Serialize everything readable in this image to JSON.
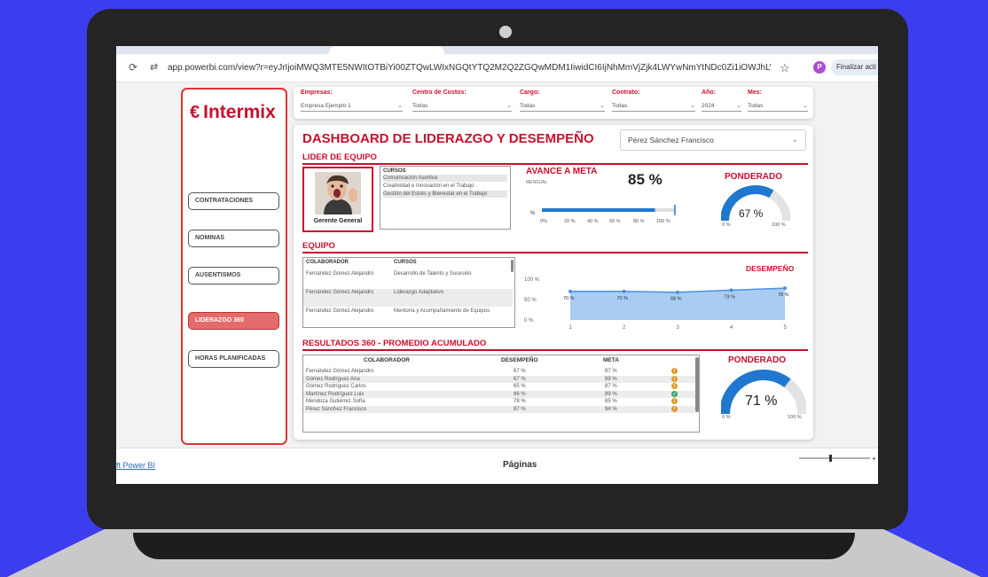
{
  "browser": {
    "url": "app.powerbi.com/view?r=eyJrIjoiMWQ3MTE5NWItOTBiYi00ZTQwLWIxNGQtYTQ2M2Q2ZGQwMDM1IiwidCI6IjNhMmVjZjk4LWYwNmYtNDc0Zi1iOWJhLW...",
    "profile_initial": "P",
    "finalize_label": "Finalizar acti",
    "icons": [
      "back-icon",
      "site-info-icon",
      "star-icon"
    ]
  },
  "brand": {
    "logo_text": "Intermix",
    "logo_symbol": "€"
  },
  "nav": {
    "items": [
      {
        "label": "CONTRATACIONES",
        "active": false
      },
      {
        "label": "NOMINAS",
        "active": false
      },
      {
        "label": "AUSENTISMOS",
        "active": false
      },
      {
        "label": "LIDERAZGO 360",
        "active": true
      },
      {
        "label": "HORAS PLANIFICADAS",
        "active": false
      }
    ]
  },
  "filters": [
    {
      "label": "Empresas:",
      "value": "Empresa Ejemplo 1"
    },
    {
      "label": "Centro de Costos:",
      "value": "Todas"
    },
    {
      "label": "Cargo:",
      "value": "Todas"
    },
    {
      "label": "Contrato:",
      "value": "Todas"
    },
    {
      "label": "Año:",
      "value": "2024"
    },
    {
      "label": "Mes:",
      "value": "Todas"
    }
  ],
  "dashboard": {
    "title": "DASHBOARD DE LIDERAZGO Y DESEMPEÑO",
    "selected_person": "Pérez Sánchez Francisco",
    "leader_section": "LIDER DE EQUIPO",
    "leader_role": "Gerente General",
    "courses_header": "CURSOS",
    "courses": [
      "Comunicación Asertiva",
      "Creatividad e Innovación en el Trabajo",
      "Gestión del Estrés y Bienestar en el Trabajo"
    ],
    "avance": {
      "title": "AVANCE A META",
      "subtitle": "MENSUAL",
      "value_label": "85 %",
      "value": 85,
      "target": 100,
      "axis_symbol": "%",
      "axis_ticks": [
        "0%",
        "20 %",
        "40 %",
        "60 %",
        "80 %",
        "100 %"
      ]
    },
    "ponderado_top": {
      "title": "PONDERADO",
      "value_label": "67 %",
      "value": 67,
      "min_label": "0 %",
      "max_label": "100 %"
    },
    "team_section": "EQUIPO",
    "team_headers": [
      "COLABORADOR",
      "CURSOS"
    ],
    "team_rows": [
      {
        "name": "Fernández Gómez Alejandro",
        "course": "Desarrollo de Talento y Sucesión"
      },
      {
        "name": "Fernández Gómez Alejandro",
        "course": "Liderazgo Adaptativo"
      },
      {
        "name": "Fernández Gómez Alejandro",
        "course": "Mentoría y Acompañamiento de Equipos"
      }
    ],
    "results_section": "RESULTADOS 360 - PROMEDIO ACUMULADO",
    "results_headers": [
      "COLABORADOR",
      "DESEMPEÑO",
      "META"
    ],
    "results_rows": [
      {
        "name": "Fernández Gómez Alejandro",
        "desempeno": "67 %",
        "meta": "87 %",
        "status": "warn"
      },
      {
        "name": "Gómez Rodríguez Ana",
        "desempeno": "67 %",
        "meta": "89 %",
        "status": "warn"
      },
      {
        "name": "Gómez Rodríguez Carlos",
        "desempeno": "65 %",
        "meta": "87 %",
        "status": "warn"
      },
      {
        "name": "Martínez Rodríguez Luis",
        "desempeno": "86 %",
        "meta": "89 %",
        "status": "ok"
      },
      {
        "name": "Mendoza Gutiérrez Sofía",
        "desempeno": "78 %",
        "meta": "85 %",
        "status": "warn"
      },
      {
        "name": "Pérez Sánchez Francisco",
        "desempeno": "87 %",
        "meta": "94 %",
        "status": "warn"
      }
    ],
    "ponderado_bottom": {
      "title": "PONDERADO",
      "value_label": "71 %",
      "value": 71,
      "min_label": "0 %",
      "max_label": "100 %"
    }
  },
  "chart_data": {
    "type": "area",
    "title": "DESEMPEÑO",
    "x": [
      1,
      2,
      3,
      4,
      5
    ],
    "values": [
      70,
      70,
      68,
      73,
      78
    ],
    "data_labels": [
      "70 %",
      "70 %",
      "68 %",
      "73 %",
      "78 %"
    ],
    "y_ticks": [
      "100 %",
      "50 %",
      "0 %"
    ],
    "ylim": [
      0,
      100
    ],
    "color": "#4a90e2"
  },
  "footer": {
    "powerbi_link": "ft Power BI",
    "pages_label": "Páginas"
  }
}
